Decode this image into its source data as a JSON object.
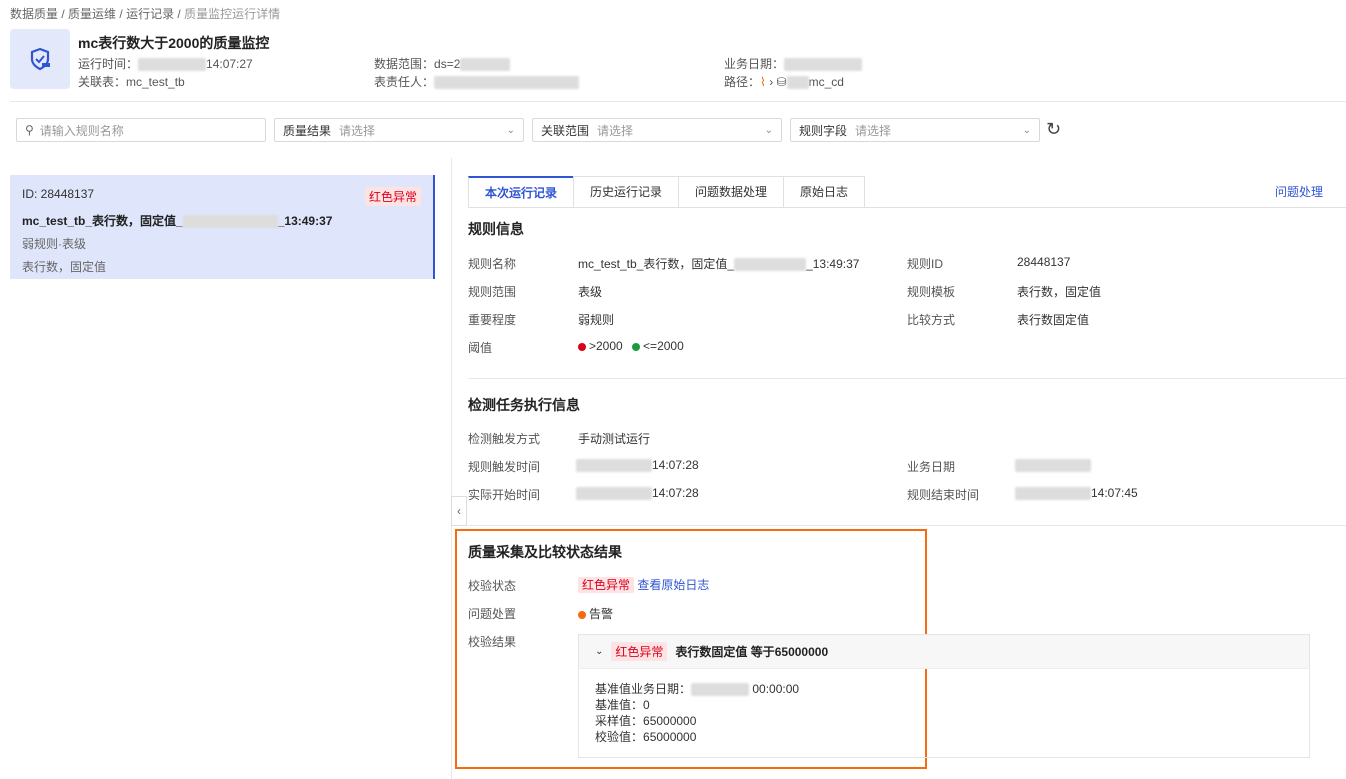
{
  "breadcrumb": [
    "数据质量",
    "质量运维",
    "运行记录",
    "质量监控运行详情"
  ],
  "header": {
    "title": "mc表行数大于2000的质量监控",
    "run_time_label": "运行时间：",
    "run_time": "14:07:27",
    "table_label": "关联表：",
    "table": "mc_test_tb",
    "range_label": "数据范围：",
    "range": "ds=2",
    "owner_label": "表责任人：",
    "bizdate_label": "业务日期：",
    "path_label": "路径：",
    "path": "mc_cd"
  },
  "filters": {
    "search_placeholder": "请输入规则名称",
    "result_label": "质量结果",
    "scope_label": "关联范围",
    "field_label": "规则字段",
    "placeholder": "请选择"
  },
  "rule_card": {
    "id": "ID: 28448137",
    "status": "红色异常",
    "name_prefix": "mc_test_tb_表行数，固定值_",
    "name_suffix": "_13:49:37",
    "type": "弱规则·表级",
    "template": "表行数，固定值"
  },
  "tabs": [
    "本次运行记录",
    "历史运行记录",
    "问题数据处理",
    "原始日志"
  ],
  "issue_link": "问题处理",
  "rule_info": {
    "title": "规则信息",
    "name_label": "规则名称",
    "name_prefix": "mc_test_tb_表行数，固定值_",
    "name_suffix": "_13:49:37",
    "id_label": "规则ID",
    "id": "28448137",
    "scope_label": "规则范围",
    "scope": "表级",
    "tpl_label": "规则模板",
    "tpl": "表行数，固定值",
    "level_label": "重要程度",
    "level": "弱规则",
    "cmp_label": "比较方式",
    "cmp": "表行数固定值",
    "thr_label": "阈值",
    "thr_red": ">2000",
    "thr_green": "<=2000",
    "red": "#d9001b",
    "green": "#1a9c3e"
  },
  "exec_info": {
    "title": "检测任务执行信息",
    "trigger_label": "检测触发方式",
    "trigger": "手动测试运行",
    "rule_trigger_label": "规则触发时间",
    "rule_trigger": "14:07:28",
    "bizdate_label": "业务日期",
    "start_label": "实际开始时间",
    "start": "14:07:28",
    "end_label": "规则结束时间",
    "end": "14:07:45"
  },
  "result": {
    "title": "质量采集及比较状态结果",
    "status_label": "校验状态",
    "status": "红色异常",
    "log_link": "查看原始日志",
    "handle_label": "问题处置",
    "handle": "告警",
    "result_label": "校验结果",
    "head_tag": "红色异常",
    "head_text": "表行数固定值 等于65000000",
    "base_date_label": "基准值业务日期：",
    "base_date": "00:00:00",
    "base_label": "基准值：",
    "base": "0",
    "sample_label": "采样值：",
    "sample": "65000000",
    "check_label": "校验值：",
    "check": "65000000"
  }
}
